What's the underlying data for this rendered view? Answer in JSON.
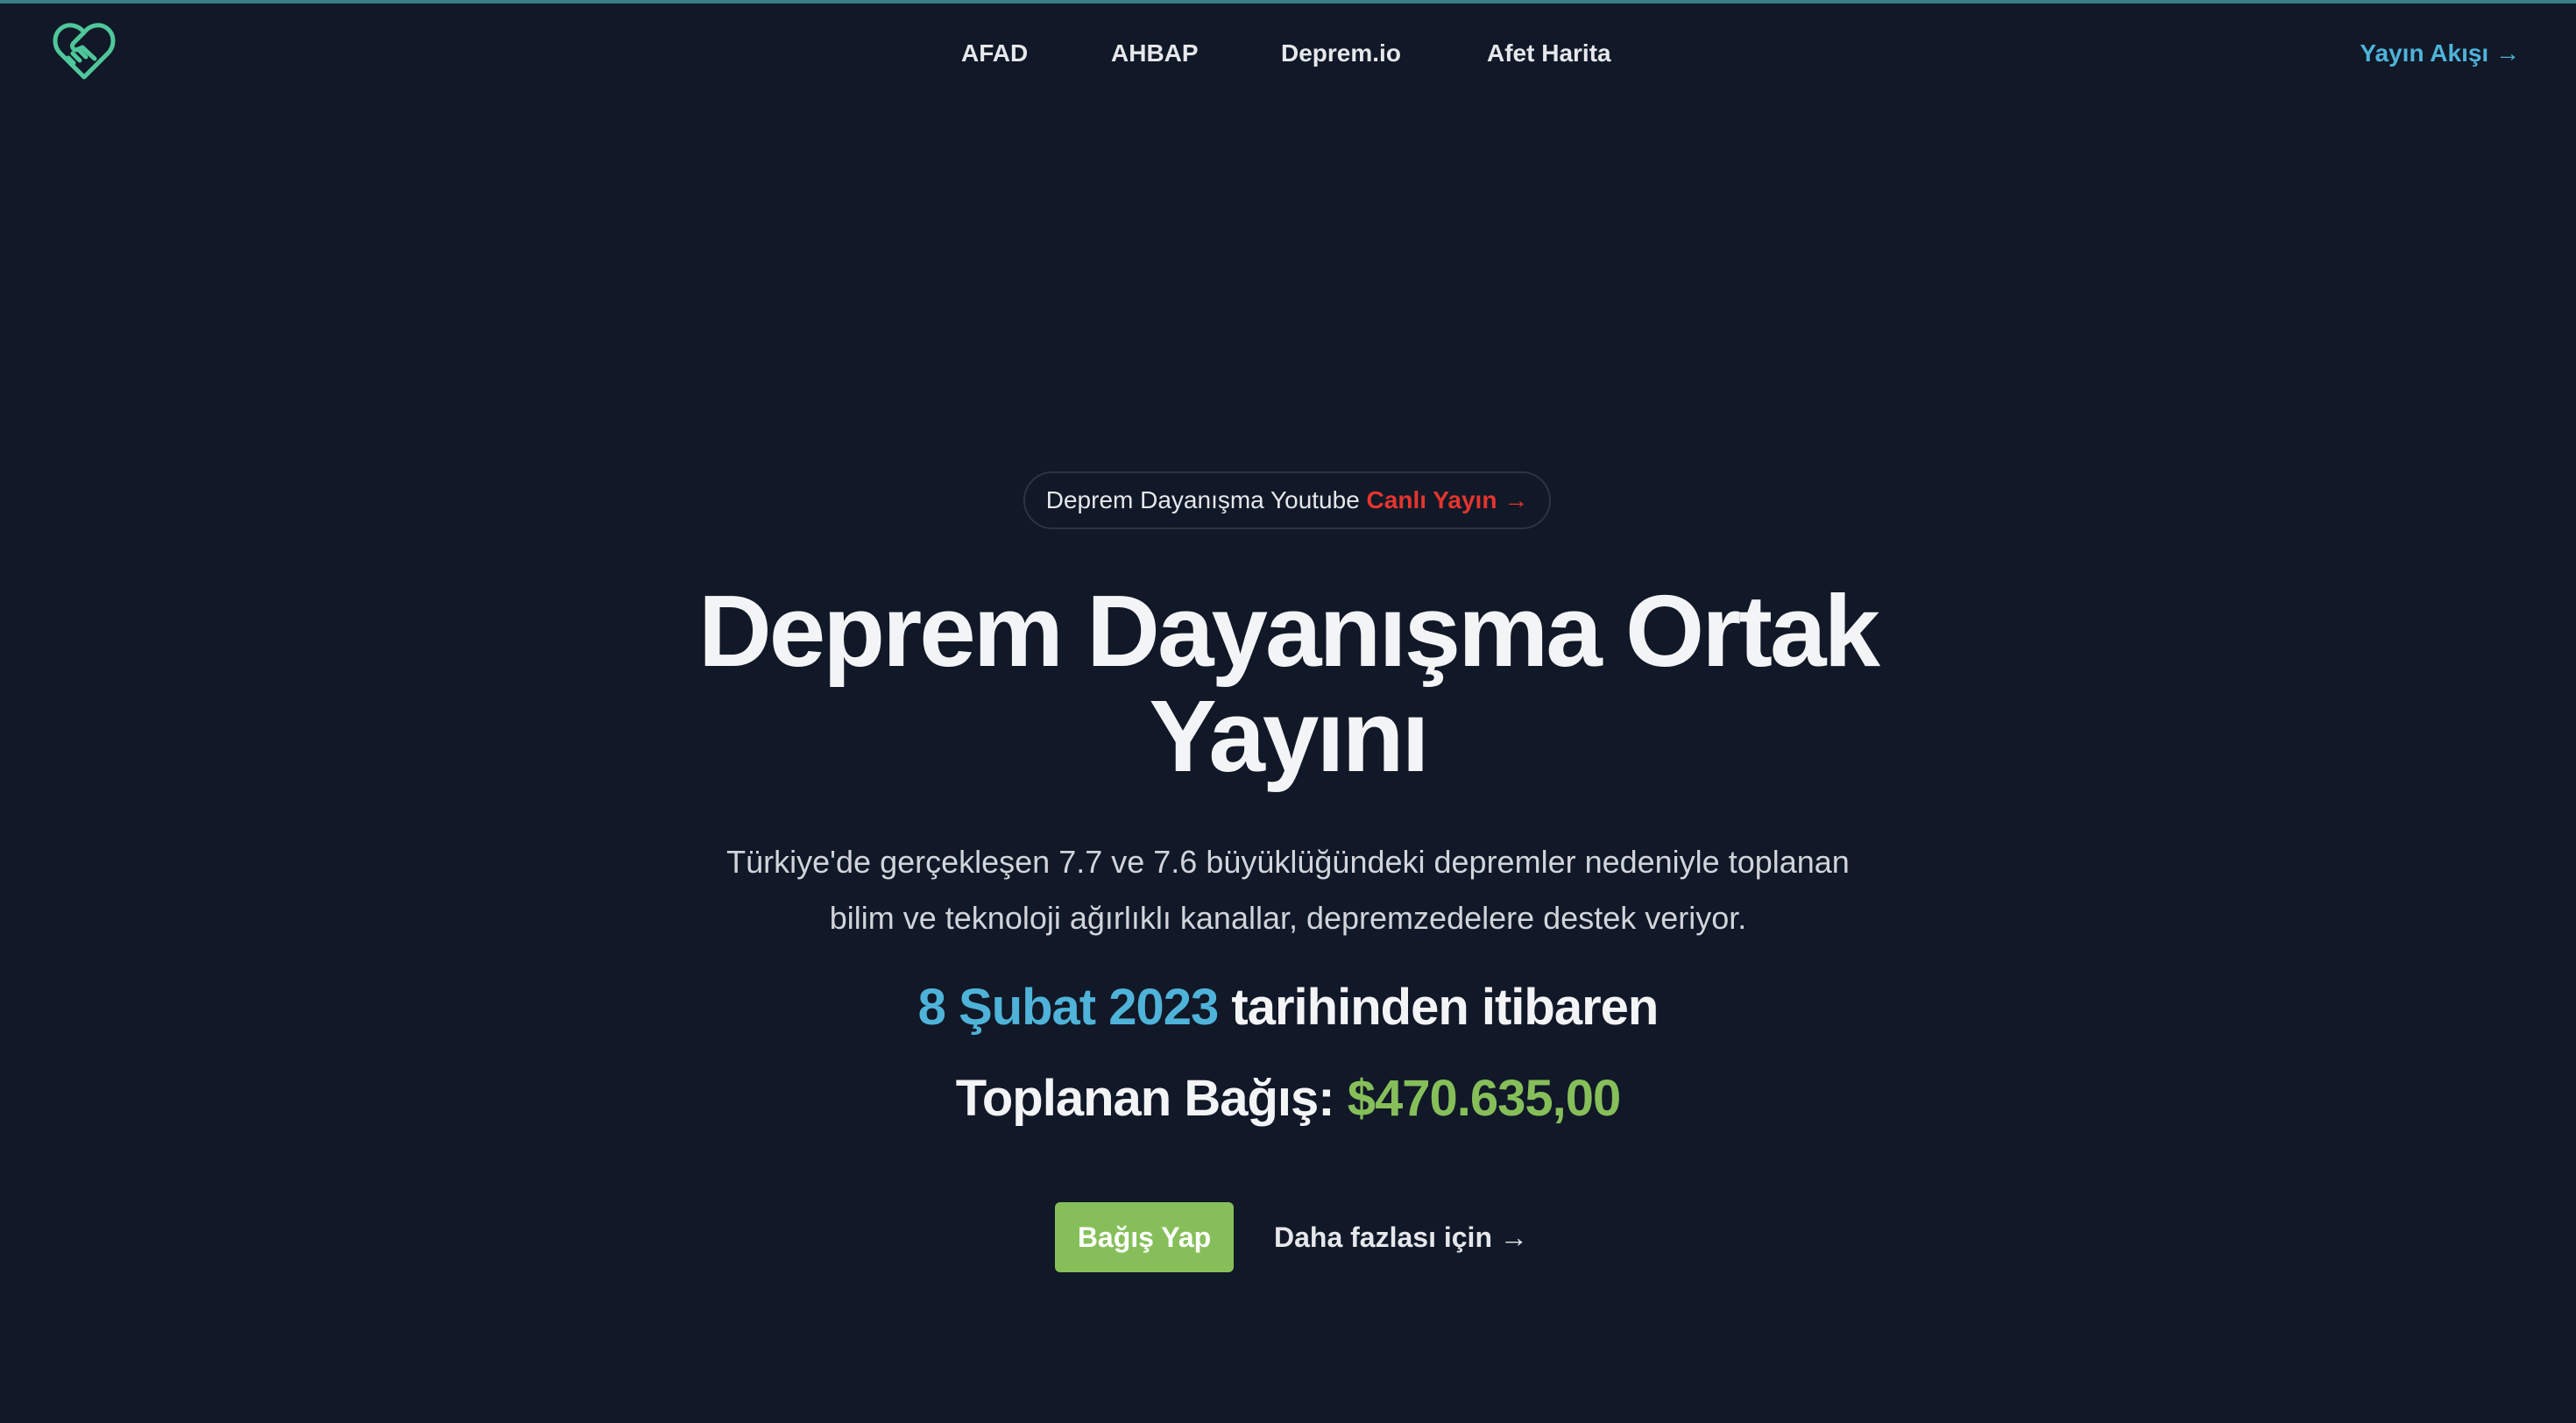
{
  "colors": {
    "background": "#111827",
    "accent_blue": "#4fb3d9",
    "accent_green": "#86bf5a",
    "live_red": "#e4352e",
    "top_strip": "#3a7f86"
  },
  "header": {
    "logo_icon": "heart-handshake-icon",
    "nav": [
      {
        "label": "AFAD"
      },
      {
        "label": "AHBAP"
      },
      {
        "label": "Deprem.io"
      },
      {
        "label": "Afet Harita"
      }
    ],
    "stream_link": "Yayın Akışı →"
  },
  "hero": {
    "pill": {
      "text": "Deprem Dayanışma Youtube",
      "live_link": "Canlı Yayın →"
    },
    "title_line1": "Deprem Dayanışma Ortak",
    "title_line2": "Yayını",
    "description_line1": "Türkiye'de gerçekleşen 7.7 ve 7.6 büyüklüğündeki depremler nedeniyle toplanan",
    "description_line2": "bilim ve teknoloji ağırlıklı kanallar, depremzedelere destek veriyor.",
    "since_date": "8 Şubat 2023",
    "since_text": "tarihinden itibaren",
    "total_label": "Toplanan Bağış:",
    "total_amount": "$470.635,00",
    "donate_button": "Bağış Yap",
    "more_link": "Daha fazlası için →"
  }
}
